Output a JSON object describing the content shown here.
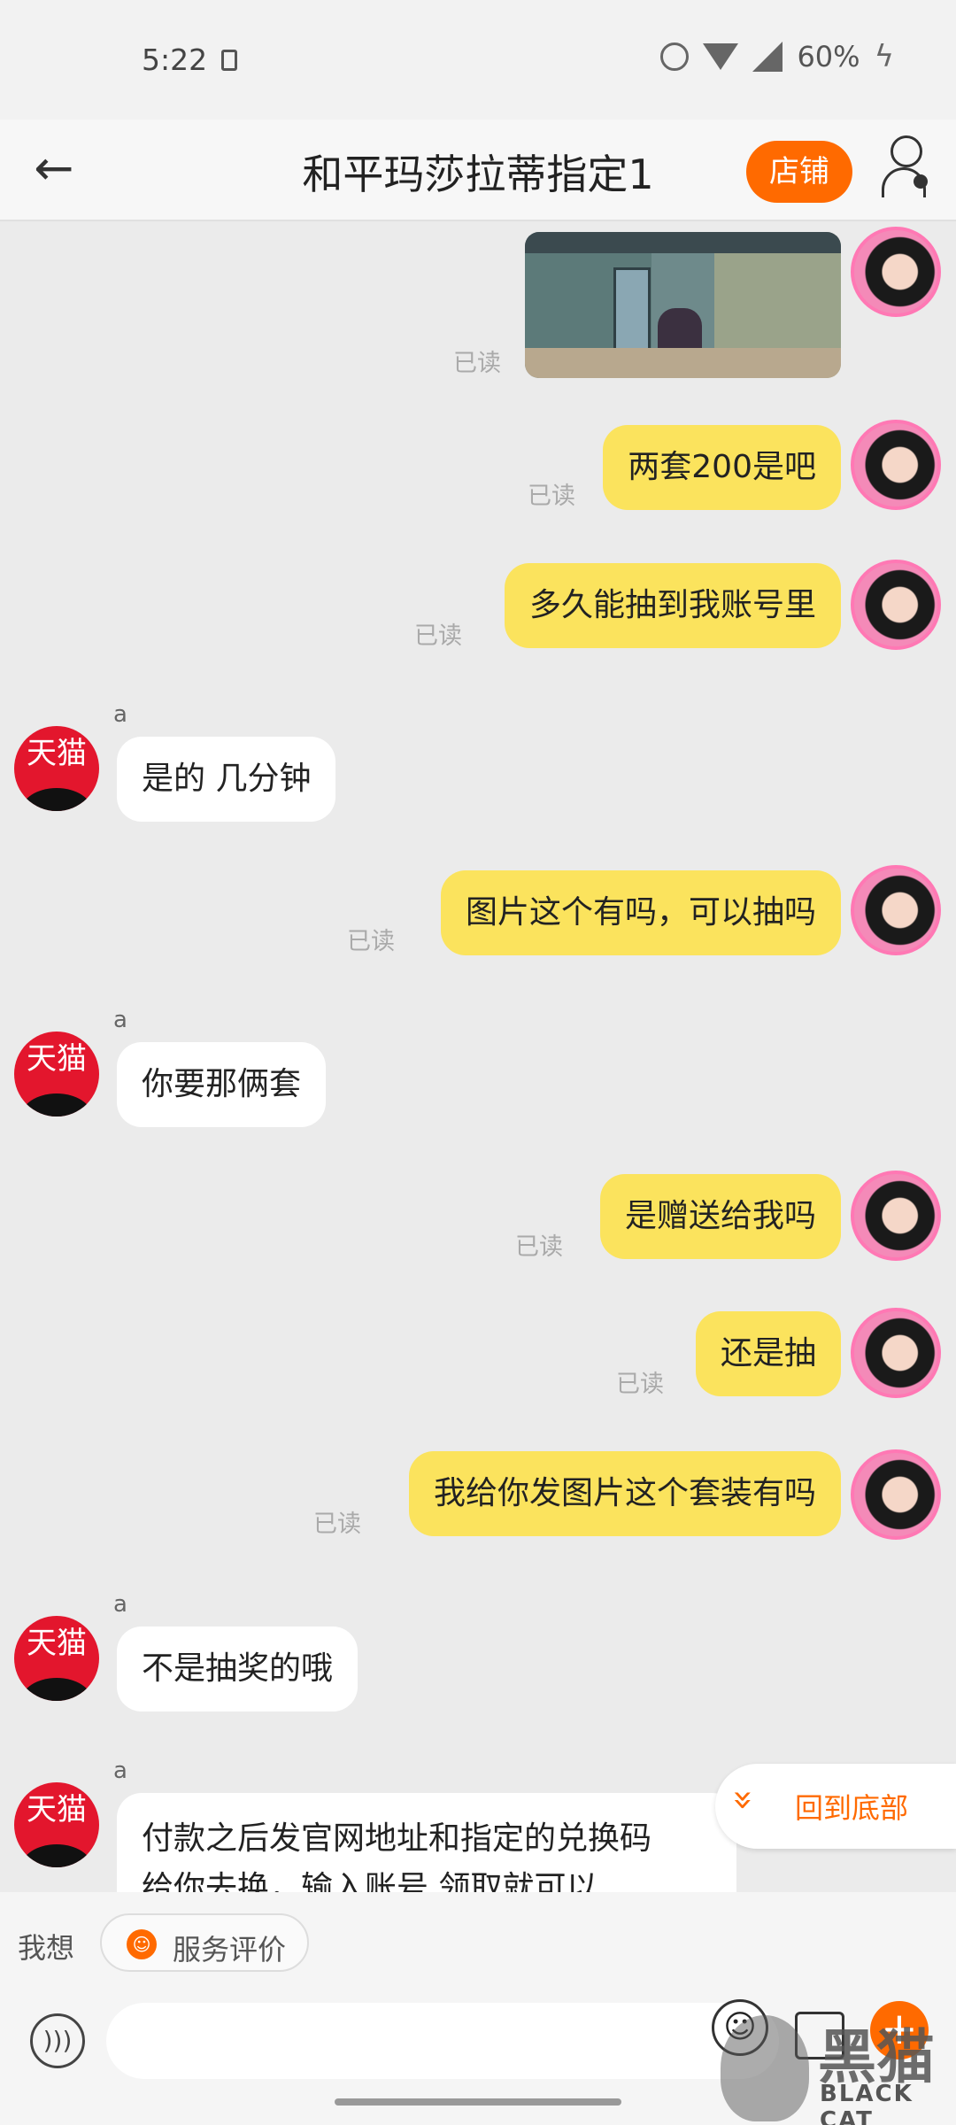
{
  "status": {
    "time": "5:22",
    "battery": "60%"
  },
  "header": {
    "title": "和平玛莎拉蒂指定1",
    "shop_button": "店铺"
  },
  "read_label": "已读",
  "sender_name": "a",
  "merchant_avatar_text": "天猫",
  "messages": [
    {
      "from": "me",
      "type": "image"
    },
    {
      "from": "me",
      "text": "两套200是吧"
    },
    {
      "from": "me",
      "text": "多久能抽到我账号里"
    },
    {
      "from": "them",
      "text": "是的 几分钟"
    },
    {
      "from": "me",
      "text": "图片这个有吗，可以抽吗"
    },
    {
      "from": "them",
      "text": "你要那俩套"
    },
    {
      "from": "me",
      "text": "是赠送给我吗"
    },
    {
      "from": "me",
      "text": "还是抽"
    },
    {
      "from": "me",
      "text": "我给你发图片这个套装有吗"
    },
    {
      "from": "them",
      "text": "不是抽奖的哦"
    },
    {
      "from": "them",
      "text_line1": "付款之后发官网地址和指定的兑换码",
      "text_line2": "给你去换，输入账号 领取就可以"
    }
  ],
  "back_to_bottom": "回到底部",
  "quick_bar": {
    "prefix": "我想",
    "chip": "服务评价"
  },
  "input": {
    "value": ""
  },
  "watermark": {
    "cn": "黑猫",
    "en": "BLACK CAT"
  }
}
